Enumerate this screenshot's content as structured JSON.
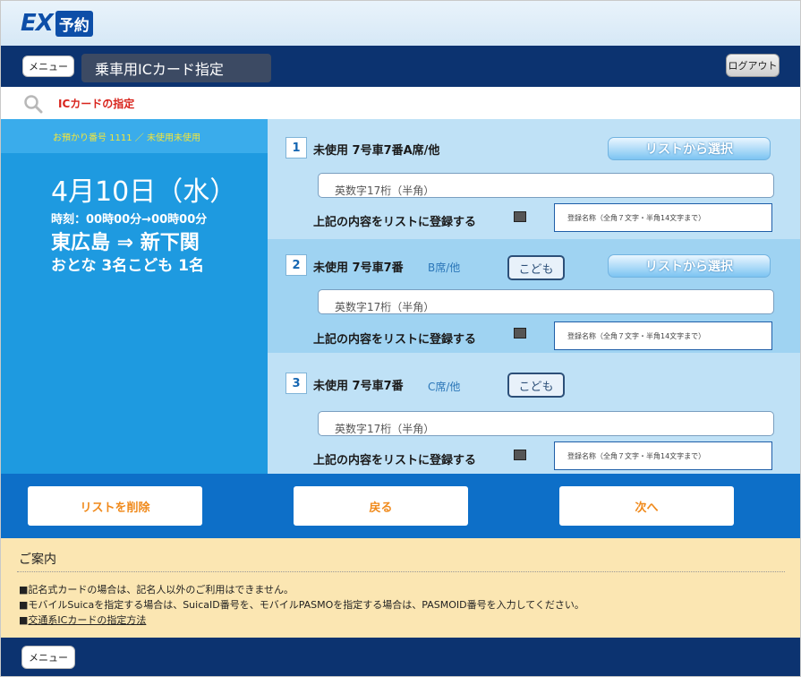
{
  "header": {
    "logo_ex": "EX",
    "logo_yoyaku": "予約",
    "menu_label": "メニュー",
    "page_title": "乗車用ICカード指定",
    "logout_label": "ログアウト"
  },
  "section": {
    "title": "ICカードの指定"
  },
  "reservation": {
    "ref_line": "お預かり番号 1111 ／ 未使用未使用",
    "date": "4月10日（水）",
    "time": "時刻：00時00分→00時00分",
    "route": "東広島 ⇒ 新下関",
    "passengers": "おとな 3名こども 1名"
  },
  "seats": [
    {
      "number": "1",
      "status_text": "未使用 7号車7番A席/他",
      "extra_text": "",
      "child_label": "",
      "list_button": "リストから選択",
      "card_placeholder": "英数字17桁（半角）",
      "register_label": "上記の内容をリストに登録する",
      "name_placeholder": "登録名称（全角７文字・半角14文字まで）"
    },
    {
      "number": "2",
      "status_text": "未使用 7号車7番",
      "extra_text": "B席/他",
      "child_label": "こども",
      "list_button": "リストから選択",
      "card_placeholder": "英数字17桁（半角）",
      "register_label": "上記の内容をリストに登録する",
      "name_placeholder": "登録名称（全角７文字・半角14文字まで）"
    },
    {
      "number": "3",
      "status_text": "未使用 7号車7番",
      "extra_text": "C席/他",
      "child_label": "こども",
      "list_button": "",
      "card_placeholder": "英数字17桁（半角）",
      "register_label": "上記の内容をリストに登録する",
      "name_placeholder": "登録名称（全角７文字・半角14文字まで）"
    }
  ],
  "actions": {
    "delete_list": "リストを削除",
    "back": "戻る",
    "next": "次へ"
  },
  "notice": {
    "title": "ご案内",
    "line1": "■記名式カードの場合は、記名人以外のご利用はできません。",
    "line2": "■モバイルSuicaを指定する場合は、SuicaID番号を、モバイルPASMOを指定する場合は、PASMOID番号を入力してください。",
    "line3_prefix": "■",
    "line3_link": "交通系ICカードの指定方法"
  },
  "footer": {
    "menu_label": "メニュー"
  },
  "colors": {
    "navy": "#0c3370",
    "blue": "#1e9ae0",
    "accent_red": "#d8241c",
    "action_orange": "#f08a1c",
    "notice_bg": "#fbe6b2"
  }
}
